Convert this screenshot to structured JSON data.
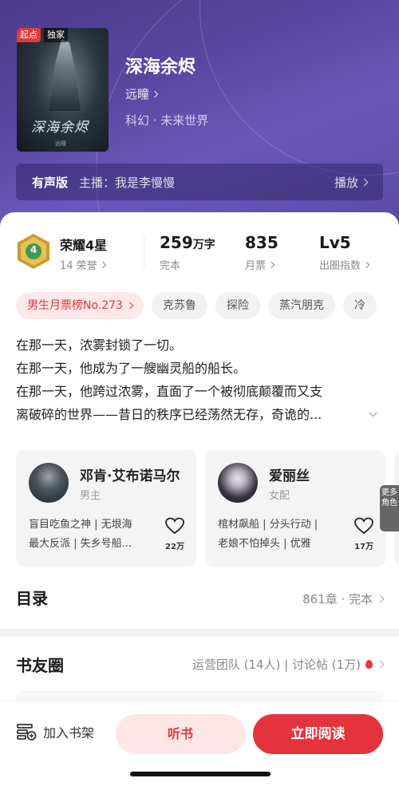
{
  "book": {
    "badge_qidian": "起点",
    "badge_exclusive": "独家",
    "cover_title": "深海余烬",
    "title": "深海余烬",
    "author": "远瞳",
    "genre": "科幻 · 未来世界"
  },
  "audio": {
    "label": "有声版",
    "host": "主播：我是李慢慢",
    "play": "播放"
  },
  "stats": {
    "honor_title": "荣耀4星",
    "honor_sub": "14 荣誉",
    "medal_level": "4",
    "words_value": "259",
    "words_unit": "万字",
    "words_sub": "完本",
    "monthly_value": "835",
    "monthly_sub": "月票",
    "level_value": "Lv5",
    "level_sub": "出圈指数"
  },
  "tags": {
    "rank": "男生月票榜No.273",
    "t1": "克苏鲁",
    "t2": "探险",
    "t3": "蒸汽朋克",
    "t4": "冷"
  },
  "description": {
    "line1": "在那一天，浓雾封锁了一切。",
    "line2": "在那一天，他成为了一艘幽灵船的船长。",
    "line3": "在那一天，他跨过浓雾，直面了一个被彻底颠覆而又支",
    "line4": "离破碎的世界——昔日的秩序已经荡然无存，奇诡的..."
  },
  "characters": [
    {
      "name": "邓肯·艾布诺马尔",
      "role": "男主",
      "trait1": "盲目吃鱼之神 | 无垠海",
      "trait2": "最大反派 | 失乡号船...",
      "likes": "22万"
    },
    {
      "name": "爱丽丝",
      "role": "女配",
      "trait1": "棺材飙船 | 分头行动 |",
      "trait2": "老娘不怕掉头 | 优雅",
      "likes": "17万"
    }
  ],
  "more_roles": "更多角色",
  "toc": {
    "title": "目录",
    "info": "861章 · 完本"
  },
  "circle": {
    "title": "书友圈",
    "info": "运营团队 (14人) | 讨论帖 (1万)"
  },
  "bottom": {
    "shelf": "加入书架",
    "listen": "听书",
    "read": "立即阅读"
  },
  "colors": {
    "accent": "#e4333c",
    "header_purple": "#5a47a3",
    "medal_gold": "#c99a2e",
    "medal_green": "#3f9b4c"
  }
}
